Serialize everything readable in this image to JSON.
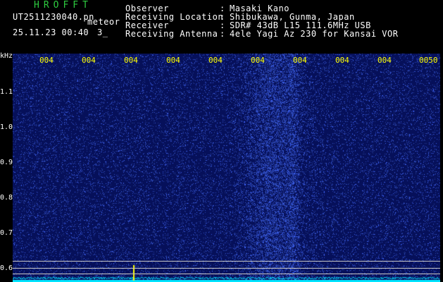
{
  "header": {
    "title": "HROFFT",
    "file_name": "UT2511230040.pn",
    "tag": "meteor",
    "datetime": "25.11.23 00:40",
    "count": "3_",
    "rows": [
      {
        "label": "Observer",
        "sep": ":",
        "value": "Masaki Kano"
      },
      {
        "label": "Receiving Location",
        "sep": ":",
        "value": "Shibukawa, Gunma, Japan"
      },
      {
        "label": "Receiver",
        "sep": ":",
        "value": "SDR# 43dB L15 111.6MHz USB"
      },
      {
        "label": "Receiving Antenna",
        "sep": ":",
        "value": "4ele Yagi Az 230 for Kansai VOR"
      }
    ]
  },
  "axis": {
    "y_unit": "kHz",
    "y_ticks": [
      "1.1",
      "1.0",
      "0.9",
      "0.8",
      "0.7",
      "0.6"
    ],
    "x_ticks": [
      "004",
      "004",
      "004",
      "004",
      "004",
      "004",
      "004",
      "004",
      "004",
      "0050"
    ]
  },
  "colors": {
    "background": "#06105a",
    "signal": "#3a6bff",
    "trace": "#00e5ff",
    "tick_text": "#ffff00",
    "title": "#2ecc40"
  }
}
